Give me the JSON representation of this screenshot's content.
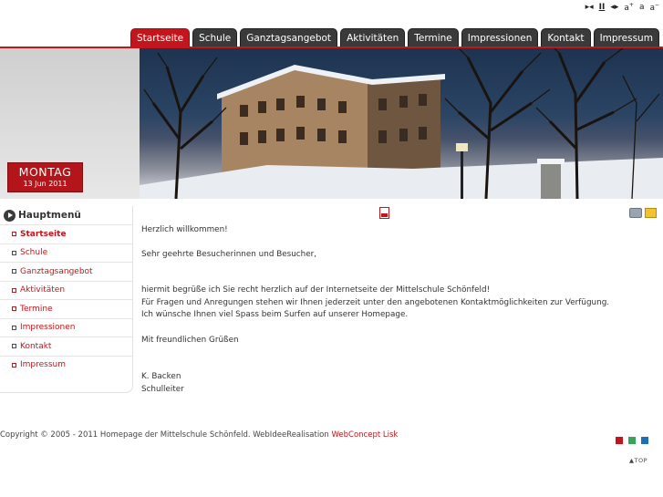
{
  "utility": {
    "icons": [
      "width-narrow-icon",
      "pause-icon",
      "width-wide-icon",
      "font-larger-icon",
      "font-normal-icon",
      "font-smaller-icon"
    ],
    "pause_label": "II",
    "font_larger": "a",
    "font_normal": "a",
    "font_smaller": "a",
    "plus": "+",
    "minus": "−"
  },
  "nav": {
    "tabs": [
      "Startseite",
      "Schule",
      "Ganztagsangebot",
      "Aktivitäten",
      "Termine",
      "Impressionen",
      "Kontakt",
      "Impressum"
    ],
    "active": "Startseite"
  },
  "date": {
    "day": "MONTAG",
    "date": "13 Jun 2011"
  },
  "sidebar": {
    "title": "Hauptmenü",
    "items": [
      "Startseite",
      "Schule",
      "Ganztagsangebot",
      "Aktivitäten",
      "Termine",
      "Impressionen",
      "Kontakt",
      "Impressum"
    ]
  },
  "content": {
    "welcome": "Herzlich willkommen!",
    "greeting": "Sehr geehrte Besucherinnen und Besucher,",
    "body": [
      "hiermit begrüße ich Sie recht herzlich auf der Internetseite der Mittelschule Schönfeld!",
      "Für Fragen und Anregungen stehen wir Ihnen jederzeit unter den angebotenen Kontaktmöglichkeiten zur Verfügung.",
      "Ich wünsche Ihnen viel Spass beim Surfen auf unserer Homepage."
    ],
    "closing": "Mit freundlichen Grüßen",
    "signature_name": "K. Backen",
    "signature_title": "Schulleiter"
  },
  "footer": {
    "copyright": "Copyright © 2005 - 2011 Homepage der Mittelschule Schönfeld. WebIdeeRealisation",
    "link": "WebConcept Lisk",
    "top": "TOP"
  },
  "colors": {
    "accent": "#c3161c",
    "tab_dark": "#3a3a3a",
    "scheme_red": "#c3161c",
    "scheme_green": "#3aa35b",
    "scheme_blue": "#1f6fb5"
  }
}
